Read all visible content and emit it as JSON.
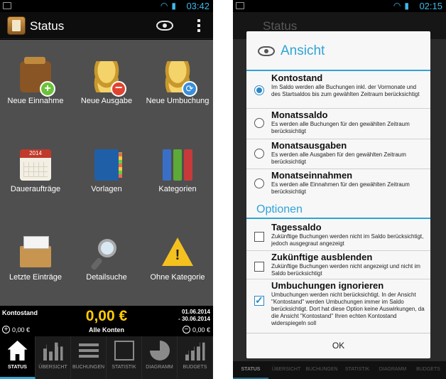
{
  "left": {
    "status_bar": {
      "time": "03:42"
    },
    "title": "Status",
    "tiles": [
      {
        "label": "Neue Einnahme"
      },
      {
        "label": "Neue Ausgabe"
      },
      {
        "label": "Neue Umbuchung"
      },
      {
        "label": "Daueraufträge",
        "badge": "2014"
      },
      {
        "label": "Vorlagen"
      },
      {
        "label": "Kategorien"
      },
      {
        "label": "Letzte Einträge"
      },
      {
        "label": "Detailsuche"
      },
      {
        "label": "Ohne Kategorie"
      }
    ],
    "summary": {
      "label": "Kontostand",
      "amount": "0,00 €",
      "date_from": "01.06.2014",
      "date_to": "- 30.06.2014",
      "left_value": "0,00 €",
      "accounts": "Alle Konten",
      "right_value": "0,00 €"
    },
    "tabs": [
      "STATUS",
      "ÜBERSICHT",
      "BUCHUNGEN",
      "STATISTIK",
      "DIAGRAMM",
      "BUDGETS"
    ]
  },
  "right": {
    "status_bar": {
      "time": "02:15"
    },
    "bg_title": "Status",
    "dialog": {
      "title": "Ansicht",
      "options": [
        {
          "title": "Kontostand",
          "desc": "Im Saldo werden alle Buchungen inkl. der Vormonate und des Startsaldos bis zum gewählten Zeitraum berücksichtigt",
          "checked": true
        },
        {
          "title": "Monatssaldo",
          "desc": "Es werden alle Buchungen für den gewählten Zeitraum berücksichtigt",
          "checked": false
        },
        {
          "title": "Monatsausgaben",
          "desc": "Es werden alle Ausgaben für den gewählten Zeitraum berücksichtigt",
          "checked": false
        },
        {
          "title": "Monatseinnahmen",
          "desc": "Es werden alle Einnahmen für den gewählten Zeitraum berücksichtigt",
          "checked": false
        }
      ],
      "section": "Optionen",
      "checkboxes": [
        {
          "title": "Tagessaldo",
          "desc": "Zukünftige Buchungen werden nicht im Saldo berücksichtigt, jedoch ausgegraut angezeigt",
          "checked": false
        },
        {
          "title": "Zukünftige ausblenden",
          "desc": "Zukünftige Buchungen werden nicht angezeigt und nicht im Saldo berücksichtigt",
          "checked": false
        },
        {
          "title": "Umbuchungen ignorieren",
          "desc": "Umbuchungen werden nicht berücksichtigt. In der Ansicht \"Kontostand\" werden Umbuchungen immer im Saldo berücksichtigt. Dort hat diese Option keine Auswirkungen, da die Ansicht \"Kontostand\" Ihren echten Kontostand widerspiegeln soll",
          "checked": true
        }
      ],
      "ok_label": "OK"
    },
    "tabs": [
      "STATUS",
      "ÜBERSICHT",
      "BUCHUNGEN",
      "STATISTIK",
      "DIAGRAMM",
      "BUDGETS"
    ]
  },
  "colors": {
    "accent": "#2ea4d8",
    "amount": "#ffcc00",
    "grid_bg": "#4f4f4f"
  }
}
